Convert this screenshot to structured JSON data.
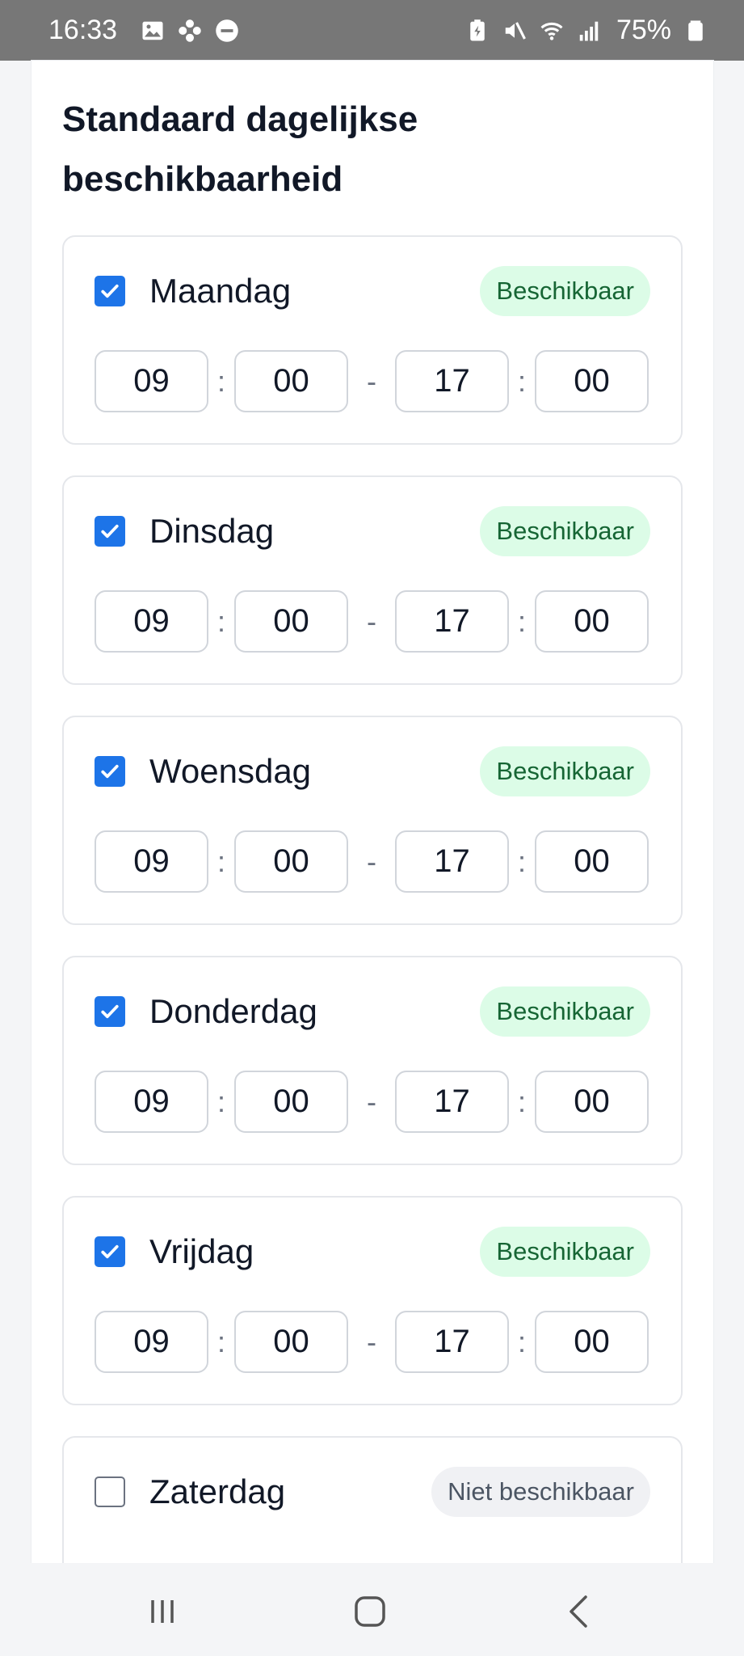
{
  "status_bar": {
    "time": "16:33",
    "battery": "75%",
    "left_icons": [
      "image-icon",
      "flower-icon",
      "do-not-disturb-icon"
    ],
    "right_icons": [
      "battery-saver-icon",
      "mute-icon",
      "wifi-icon",
      "signal-icon",
      "battery-icon"
    ]
  },
  "section": {
    "title": "Standaard dagelijkse beschikbaarheid"
  },
  "days": [
    {
      "name": "Maandag",
      "checked": true,
      "status": "Beschikbaar",
      "start_hour": "09",
      "start_min": "00",
      "end_hour": "17",
      "end_min": "00"
    },
    {
      "name": "Dinsdag",
      "checked": true,
      "status": "Beschikbaar",
      "start_hour": "09",
      "start_min": "00",
      "end_hour": "17",
      "end_min": "00"
    },
    {
      "name": "Woensdag",
      "checked": true,
      "status": "Beschikbaar",
      "start_hour": "09",
      "start_min": "00",
      "end_hour": "17",
      "end_min": "00"
    },
    {
      "name": "Donderdag",
      "checked": true,
      "status": "Beschikbaar",
      "start_hour": "09",
      "start_min": "00",
      "end_hour": "17",
      "end_min": "00"
    },
    {
      "name": "Vrijdag",
      "checked": true,
      "status": "Beschikbaar",
      "start_hour": "09",
      "start_min": "00",
      "end_hour": "17",
      "end_min": "00"
    },
    {
      "name": "Zaterdag",
      "checked": false,
      "status": "Niet beschikbaar"
    }
  ],
  "separators": {
    "colon": ":",
    "dash": "-"
  },
  "colors": {
    "accent": "#1d74e8",
    "available_bg": "#dcfce7",
    "available_text": "#166534",
    "unavailable_bg": "#f0f1f4",
    "unavailable_text": "#4b5563"
  },
  "nav_bar": {
    "icons": [
      "recent-apps-icon",
      "home-icon",
      "back-icon"
    ]
  }
}
